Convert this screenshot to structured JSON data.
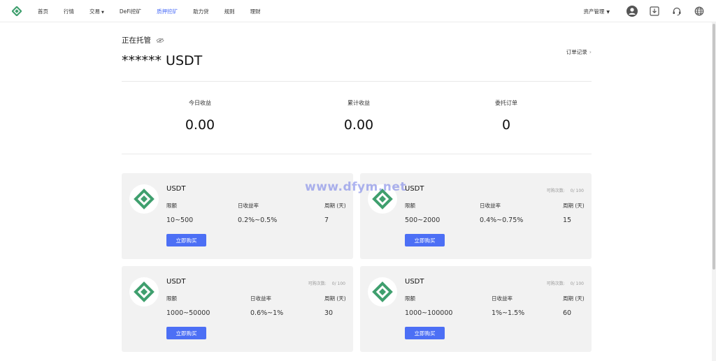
{
  "nav": {
    "items": [
      {
        "label": "首页",
        "active": false,
        "dropdown": false
      },
      {
        "label": "行情",
        "active": false,
        "dropdown": false
      },
      {
        "label": "交易",
        "active": false,
        "dropdown": true
      },
      {
        "label": "DeFi挖矿",
        "active": false,
        "dropdown": false
      },
      {
        "label": "质押挖矿",
        "active": true,
        "dropdown": false
      },
      {
        "label": "助力贷",
        "active": false,
        "dropdown": false
      },
      {
        "label": "规则",
        "active": false,
        "dropdown": false
      },
      {
        "label": "理财",
        "active": false,
        "dropdown": false
      }
    ],
    "asset_menu": "资产管理",
    "icons": [
      "user-avatar-icon",
      "download-icon",
      "headset-icon",
      "globe-icon"
    ]
  },
  "colors": {
    "accent": "#4c6ff5",
    "brand_green": "#3f9f6e",
    "card_bg": "#f2f2f2"
  },
  "summary": {
    "title": "正在托管",
    "amount": "****** USDT",
    "order_link": "订单记录",
    "stats": [
      {
        "label": "今日收益",
        "value": "0.00"
      },
      {
        "label": "累计收益",
        "value": "0.00"
      },
      {
        "label": "委托订单",
        "value": "0"
      }
    ]
  },
  "products": [
    {
      "coin": "USDT",
      "remaining_label": "",
      "remaining": "",
      "limit_label": "限额",
      "limit": "10~500",
      "rate_label": "日收益率",
      "rate": "0.2%~0.5%",
      "period_label": "周期 (天)",
      "period": "7",
      "buy_label": "立即购买"
    },
    {
      "coin": "USDT",
      "remaining_label": "可购次数:",
      "remaining": "0/ 100",
      "limit_label": "限额",
      "limit": "500~2000",
      "rate_label": "日收益率",
      "rate": "0.4%~0.75%",
      "period_label": "周期 (天)",
      "period": "15",
      "buy_label": "立即购买"
    },
    {
      "coin": "USDT",
      "remaining_label": "可购次数:",
      "remaining": "0/ 100",
      "limit_label": "限额",
      "limit": "1000~50000",
      "rate_label": "日收益率",
      "rate": "0.6%~1%",
      "period_label": "周期 (天)",
      "period": "30",
      "buy_label": "立即购买"
    },
    {
      "coin": "USDT",
      "remaining_label": "可购次数:",
      "remaining": "0/ 100",
      "limit_label": "限额",
      "limit": "1000~100000",
      "rate_label": "日收益率",
      "rate": "1%~1.5%",
      "period_label": "周期 (天)",
      "period": "60",
      "buy_label": "立即购买"
    }
  ],
  "watermark": "www.dfym.net"
}
